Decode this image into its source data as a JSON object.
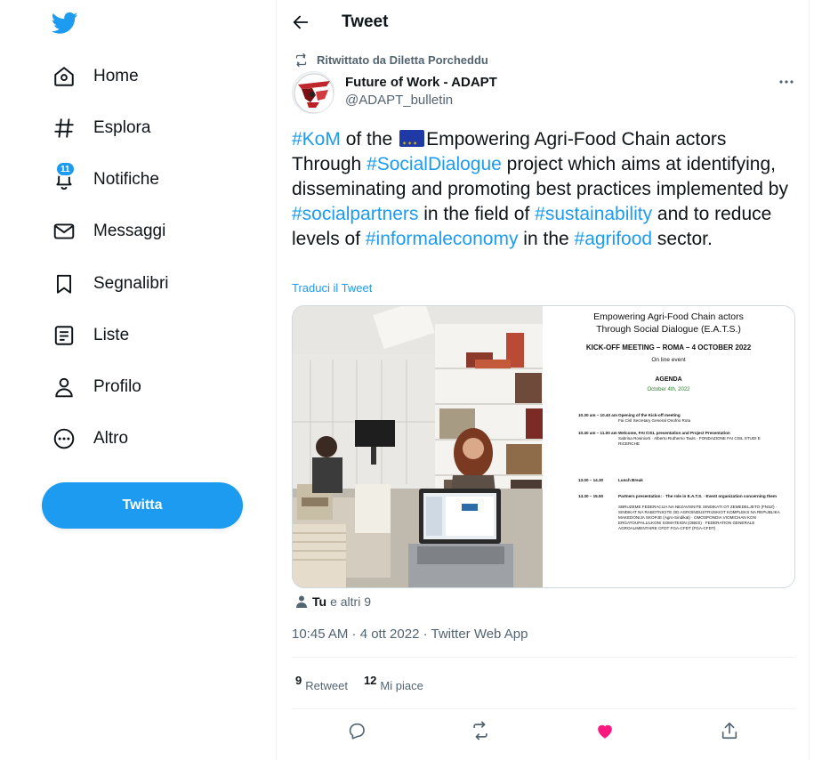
{
  "sidebar": {
    "nav": [
      {
        "label": "Home",
        "icon": "home-icon"
      },
      {
        "label": "Esplora",
        "icon": "hashtag-icon"
      },
      {
        "label": "Notifiche",
        "icon": "bell-icon",
        "badge": "11"
      },
      {
        "label": "Messaggi",
        "icon": "mail-icon"
      },
      {
        "label": "Segnalibri",
        "icon": "bookmark-icon"
      },
      {
        "label": "Liste",
        "icon": "list-icon"
      },
      {
        "label": "Profilo",
        "icon": "person-icon"
      },
      {
        "label": "Altro",
        "icon": "more-circle-icon"
      }
    ],
    "tweet_button": "Twitta",
    "brand_color": "#1d9bf0"
  },
  "header": {
    "title": "Tweet"
  },
  "tweet": {
    "retweeted_by": "Ritwittato da Diletta Porcheddu",
    "author_name": "Future of Work - ADAPT",
    "author_handle": "@ADAPT_bulletin",
    "text_parts": {
      "p1": "#KoM",
      "p2": " of the ",
      "p3": "Empowering Agri-Food Chain actors Through ",
      "p4": "#SocialDialogue",
      "p5": " project which aims at identifying, disseminating and promoting best practices implemented by ",
      "p6": "#socialpartners",
      "p7": " in the field of ",
      "p8": "#sustainability",
      "p9": " and to reduce levels of ",
      "p10": "#informaleconomy",
      "p11": " in the ",
      "p12": "#agrifood",
      "p13": " sector."
    },
    "translate_label": "Traduci il Tweet",
    "media_doc": {
      "title_line1": "Empowering Agri-Food Chain actors",
      "title_line2": "Through Social Dialogue (E.A.T.S.)",
      "kickoff": "KICK-OFF MEETING – ROMA – 4 OCTOBER  2022",
      "online": "On line event",
      "agenda": "AGENDA",
      "date": "October 4th, 2022",
      "rows": [
        {
          "time": "10.30 am – 10.40 am",
          "desc": "Opening of the Kick-off meeting",
          "sub": "Fai Cisl Secretary General Onofrio Rota"
        },
        {
          "time": "10.40 am – 11.00 am",
          "desc": "Welcome, FAI CISL presentation and Project Presentation",
          "sub": "Sabrina Rosiniorti · Alberto Rutherno Tauls · FONDAZIONE FAI CISL STUDI E RICERCHE"
        },
        {
          "time": "13.00 – 14.30",
          "desc": "Lunch Break",
          "sub": ""
        },
        {
          "time": "14.30 – 15.50",
          "desc": "Partners presentation: · The role in E.A.T.S. · Event organization concerning them",
          "sub": "SBRUZEME FEDERACIJA NA NEZAVISNITE SINDIKATI OT ZEMEDELJETO (FNSZ) · SINDIKAT NA RABOTNICITE OD AGROINDUSTRIJSKIOT KOMPLEKS NA REPUBLIKA MAKEDONIJA SKOPJE (Agro-Sindikat) · OMOSPONDIA VIOMICHAN KON ERGATOUPALLILKON/ SOMATEION (OBES) · FEDERATION GENERALE AGROALIMENTAIRE CFDT FGA-CFDT (FGA-CFDT)"
        }
      ]
    },
    "likers": {
      "bold": "Tu",
      "rest": "e altri 9"
    },
    "timestamp": "10:45 AM · 4 ott 2022 · Twitter Web App",
    "stats": {
      "retweets_count": "9",
      "retweets_label": "Retweet",
      "likes_count": "12",
      "likes_label": "Mi piace"
    },
    "actions": [
      "reply-icon",
      "retweet-icon",
      "heart-icon",
      "share-icon"
    ],
    "like_color": "#f91880",
    "hashtag_color": "#1d9bf0"
  }
}
